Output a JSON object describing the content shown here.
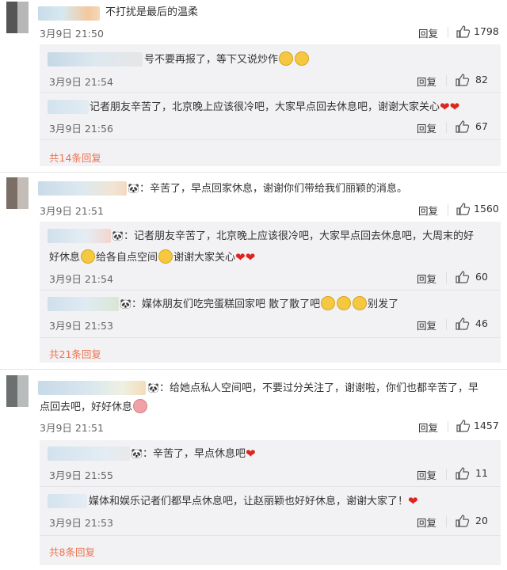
{
  "comments": [
    {
      "text": "不打扰是最后的温柔",
      "time": "3月9日 21:50",
      "reply_label": "回复",
      "likes": "1798",
      "replies": [
        {
          "text": "号不要再报了，等下又说炒作",
          "time": "3月9日 21:54",
          "reply_label": "回复",
          "likes": "82"
        },
        {
          "text": "记者朋友辛苦了，北京晚上应该很冷吧，大家早点回去休息吧，谢谢大家关心",
          "time": "3月9日 21:56",
          "reply_label": "回复",
          "likes": "67"
        }
      ],
      "more": "共14条回复"
    },
    {
      "text": "：辛苦了，早点回家休息，谢谢你们带给我们丽颖的消息。",
      "time": "3月9日 21:51",
      "reply_label": "回复",
      "likes": "1560",
      "replies": [
        {
          "text1": "：记者朋友辛苦了，北京晚上应该很冷吧，大家早点回去休息吧，大周末的好",
          "text2a": "好休息",
          "text2b": "给各自点空间",
          "text2c": "谢谢大家关心",
          "time": "3月9日 21:54",
          "reply_label": "回复",
          "likes": "60"
        },
        {
          "text_a": "：媒体朋友们吃完蛋糕回家吧 散了散了吧",
          "text_b": "别发了",
          "time": "3月9日 21:53",
          "reply_label": "回复",
          "likes": "46"
        }
      ],
      "more": "共21条回复"
    },
    {
      "text1": "：给她点私人空间吧，不要过分关注了，谢谢啦，你们也都辛苦了，早",
      "text2": "点回去吧，好好休息",
      "time": "3月9日 21:51",
      "reply_label": "回复",
      "likes": "1457",
      "replies": [
        {
          "text": "：辛苦了，早点休息吧",
          "time": "3月9日 21:55",
          "reply_label": "回复",
          "likes": "11"
        },
        {
          "text": "媒体和娱乐记者们都早点休息吧，让赵丽颖也好好休息，谢谢大家了！",
          "time": "3月9日 21:53",
          "reply_label": "回复",
          "likes": "20"
        }
      ],
      "more": "共8条回复"
    }
  ],
  "icons": {
    "like": "thumbs-up-icon",
    "emoji": "emoji-face-icon",
    "heart": "red-heart-icon",
    "panda": "panda-icon"
  },
  "colors": {
    "more_link": "#eb7350",
    "sub_bg": "#f2f2f5",
    "heart": "#e0241c"
  }
}
